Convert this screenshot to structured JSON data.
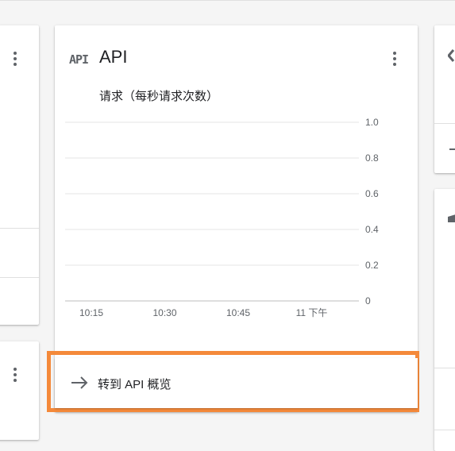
{
  "api_card": {
    "icon": "api-icon",
    "icon_text": "API",
    "title": "API",
    "subtitle": "请求（每秒请求次数）",
    "menu_icon": "more-vert-icon"
  },
  "chart_data": {
    "type": "line",
    "title": "请求（每秒请求次数）",
    "xlabel": "",
    "ylabel": "",
    "x_ticks": [
      "10:15",
      "10:30",
      "10:45",
      "11 下午"
    ],
    "y_ticks": [
      1.0,
      0.8,
      0.6,
      0.4,
      0.2,
      0
    ],
    "y_tick_labels": [
      "1.0",
      "0.8",
      "0.6",
      "0.4",
      "0.2",
      "0"
    ],
    "ylim": [
      0,
      1.0
    ],
    "series": [],
    "grid": true
  },
  "goto_link": {
    "icon": "arrow-forward-icon",
    "label": "转到 API 概览"
  },
  "colors": {
    "highlight": "#f4893a",
    "background": "#f5f5f5",
    "card": "#ffffff"
  }
}
